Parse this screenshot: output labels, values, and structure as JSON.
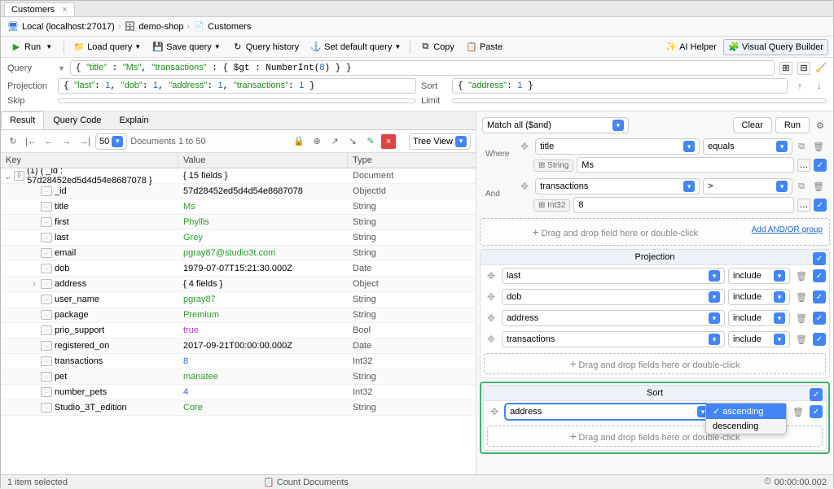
{
  "tab": {
    "label": "Customers"
  },
  "breadcrumb": [
    {
      "icon": "server",
      "label": "Local (localhost:27017)"
    },
    {
      "icon": "db",
      "label": "demo-shop"
    },
    {
      "icon": "coll",
      "label": "Customers"
    }
  ],
  "toolbar": {
    "run": "Run",
    "load_query": "Load query",
    "save_query": "Save query",
    "query_history": "Query history",
    "set_default": "Set default query",
    "copy": "Copy",
    "paste": "Paste",
    "ai_helper": "AI Helper",
    "visual_builder": "Visual Query Builder"
  },
  "query": {
    "label": "Query",
    "display": "{ \"title\" : \"Ms\", \"transactions\" : { $gt : NumberInt(8) } }",
    "projection_label": "Projection",
    "projection": "{ \"last\": 1, \"dob\": 1, \"address\": 1, \"transactions\": 1 }",
    "sort_label": "Sort",
    "sort": "{ \"address\": 1 }",
    "skip_label": "Skip",
    "limit_label": "Limit"
  },
  "sub_tabs": [
    "Result",
    "Query Code",
    "Explain"
  ],
  "result_bar": {
    "page_size": "50",
    "doc_range": "Documents 1 to 50",
    "view": "Tree View"
  },
  "tree": {
    "headers": {
      "key": "Key",
      "value": "Value",
      "type": "Type"
    },
    "root": {
      "key": "(1) { _id : 57d28452ed5d4d54e8687078 }",
      "value": "{ 15 fields }",
      "type": "Document"
    },
    "rows": [
      {
        "key": "_id",
        "value": "57d28452ed5d4d54e8687078",
        "type": "ObjectId",
        "cls": ""
      },
      {
        "key": "title",
        "value": "Ms",
        "type": "String",
        "cls": "val-green"
      },
      {
        "key": "first",
        "value": "Phyllis",
        "type": "String",
        "cls": "val-green"
      },
      {
        "key": "last",
        "value": "Grey",
        "type": "String",
        "cls": "val-green"
      },
      {
        "key": "email",
        "value": "pgray87@studio3t.com",
        "type": "String",
        "cls": "val-green"
      },
      {
        "key": "dob",
        "value": "1979-07-07T15:21:30.000Z",
        "type": "Date",
        "cls": ""
      },
      {
        "key": "address",
        "value": "{ 4 fields }",
        "type": "Object",
        "cls": "",
        "expandable": true
      },
      {
        "key": "user_name",
        "value": "pgray87",
        "type": "String",
        "cls": "val-green"
      },
      {
        "key": "package",
        "value": "Premium",
        "type": "String",
        "cls": "val-green"
      },
      {
        "key": "prio_support",
        "value": "true",
        "type": "Bool",
        "cls": "val-true"
      },
      {
        "key": "registered_on",
        "value": "2017-09-21T00:00:00.000Z",
        "type": "Date",
        "cls": ""
      },
      {
        "key": "transactions",
        "value": "8",
        "type": "Int32",
        "cls": "val-blue"
      },
      {
        "key": "pet",
        "value": "manatee",
        "type": "String",
        "cls": "val-green"
      },
      {
        "key": "number_pets",
        "value": "4",
        "type": "Int32",
        "cls": "val-blue"
      },
      {
        "key": "Studio_3T_edition",
        "value": "Core",
        "type": "String",
        "cls": "val-green"
      }
    ]
  },
  "status": {
    "selected": "1 item selected",
    "count": "Count Documents",
    "time": "00:00:00.002"
  },
  "vqb": {
    "match_mode": "Match all ($and)",
    "clear": "Clear",
    "run": "Run",
    "where_label": "Where",
    "and_label": "And",
    "where_clauses": [
      {
        "field": "title",
        "op": "equals",
        "type": "String",
        "value": "Ms"
      },
      {
        "field": "transactions",
        "op": ">",
        "type": "Int32",
        "value": "8"
      }
    ],
    "drop_hint": "Drag and drop field here or double-click",
    "add_group": "Add AND/OR group",
    "projection_title": "Projection",
    "projection_items": [
      {
        "field": "last",
        "setting": "include"
      },
      {
        "field": "dob",
        "setting": "include"
      },
      {
        "field": "address",
        "setting": "include"
      },
      {
        "field": "transactions",
        "setting": "include"
      }
    ],
    "drop_fields_hint": "Drag and drop fields here or double-click",
    "sort_title": "Sort",
    "sort_field": "address",
    "sort_options": [
      "ascending",
      "descending"
    ],
    "sort_selected": "ascending"
  }
}
